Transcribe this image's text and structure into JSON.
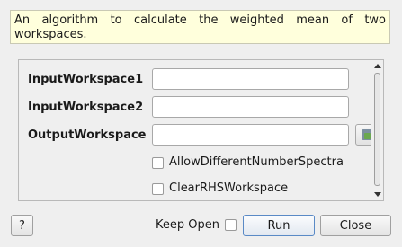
{
  "description": "An algorithm to calculate the weighted mean of two workspaces.",
  "properties": [
    {
      "label": "InputWorkspace1",
      "value": ""
    },
    {
      "label": "InputWorkspace2",
      "value": ""
    },
    {
      "label": "OutputWorkspace",
      "value": ""
    }
  ],
  "checkboxes": [
    {
      "label": "AllowDifferentNumberSpectra",
      "checked": false
    },
    {
      "label": "ClearRHSWorkspace",
      "checked": false
    }
  ],
  "footer": {
    "help_label": "?",
    "keep_open_label": "Keep Open",
    "run_label": "Run",
    "close_label": "Close"
  }
}
